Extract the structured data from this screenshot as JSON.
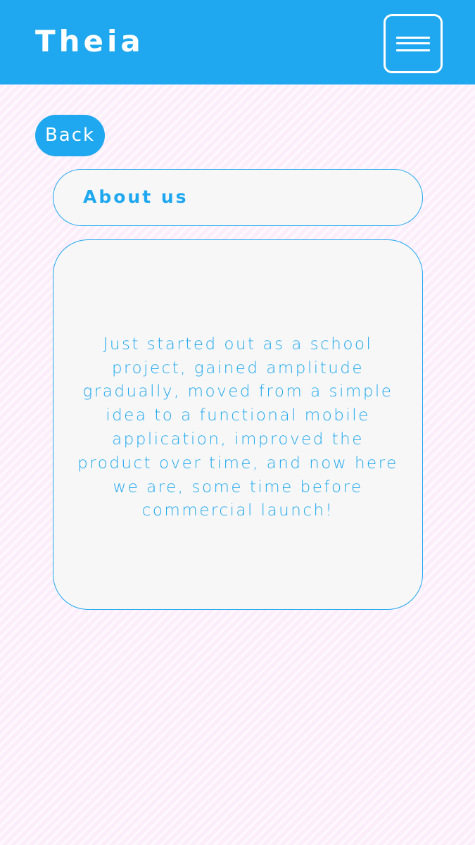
{
  "header": {
    "app_title": "Theia",
    "menu_icon": "hamburger-menu-icon"
  },
  "nav": {
    "back_label": "Back"
  },
  "about": {
    "heading": "About us",
    "body": "Just started out as a school project, gained amplitude gradually, moved from a simple idea to a functional mobile application, improved the product over time, and now here we are, some time before commercial launch!"
  },
  "colors": {
    "accent": "#1fa8ef",
    "card_background": "#f7f7f7",
    "page_background": "#fcedfb",
    "header_text": "#ffffff"
  }
}
